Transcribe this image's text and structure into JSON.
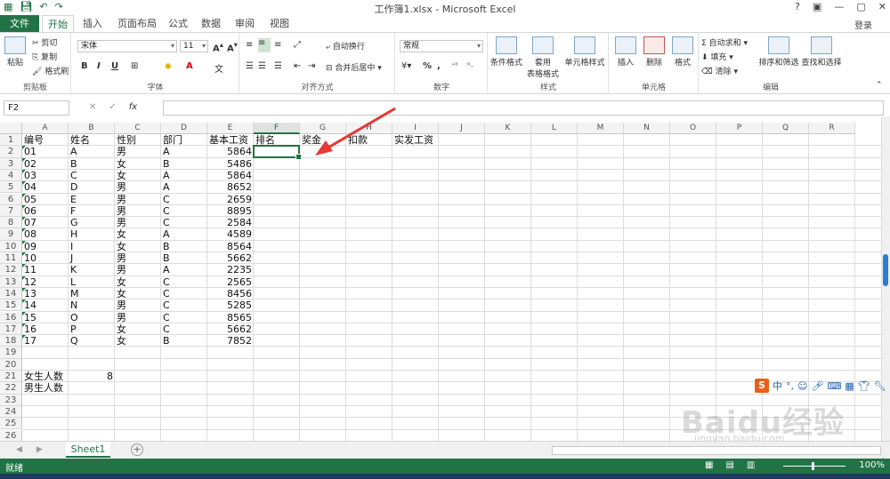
{
  "title": "工作簿1.xlsx - Microsoft Excel",
  "window_buttons": [
    "?",
    "▣",
    "—",
    "▢",
    "✕"
  ],
  "login": "登录",
  "tabs": [
    "文件",
    "开始",
    "插入",
    "页面布局",
    "公式",
    "数据",
    "审阅",
    "视图"
  ],
  "ribbon": {
    "clipboard": {
      "paste": "粘贴",
      "cut": "剪切",
      "copy": "复制",
      "format_painter": "格式刷",
      "label": "剪贴板"
    },
    "font": {
      "name": "宋体",
      "size": "11",
      "bold": "B",
      "italic": "I",
      "underline": "U",
      "label": "字体"
    },
    "alignment": {
      "wrap": "自动换行",
      "merge": "合并后居中",
      "label": "对齐方式"
    },
    "number": {
      "format": "常规",
      "percent": "%",
      "comma": ",",
      "label": "数字"
    },
    "styles": {
      "conditional": "条件格式",
      "table1": "套用",
      "table2": "表格格式",
      "cell_styles": "单元格样式",
      "label": "样式"
    },
    "cells": {
      "insert": "插入",
      "delete": "删除",
      "format": "格式",
      "label": "单元格"
    },
    "editing": {
      "autosum": "自动求和",
      "fill": "填充",
      "clear": "清除",
      "sort": "排序和筛选",
      "find": "查找和选择",
      "label": "编辑"
    }
  },
  "formula_bar": {
    "name_box": "F2",
    "fx": "fx",
    "content": ""
  },
  "columns": [
    "A",
    "B",
    "C",
    "D",
    "E",
    "F",
    "G",
    "H",
    "I",
    "J",
    "K",
    "L",
    "M",
    "N",
    "O",
    "P",
    "Q",
    "R"
  ],
  "selected_column": "F",
  "selected_cell": "F2",
  "headers": [
    "编号",
    "姓名",
    "性别",
    "部门",
    "基本工资",
    "排名",
    "奖金",
    "扣款",
    "实发工资"
  ],
  "rows": [
    [
      "01",
      "A",
      "男",
      "A",
      "5864"
    ],
    [
      "02",
      "B",
      "女",
      "B",
      "5486"
    ],
    [
      "03",
      "C",
      "女",
      "A",
      "5864"
    ],
    [
      "04",
      "D",
      "男",
      "A",
      "8652"
    ],
    [
      "05",
      "E",
      "男",
      "C",
      "2659"
    ],
    [
      "06",
      "F",
      "男",
      "C",
      "8895"
    ],
    [
      "07",
      "G",
      "男",
      "C",
      "2584"
    ],
    [
      "08",
      "H",
      "女",
      "A",
      "4589"
    ],
    [
      "09",
      "I",
      "女",
      "B",
      "8564"
    ],
    [
      "10",
      "J",
      "男",
      "B",
      "5662"
    ],
    [
      "11",
      "K",
      "男",
      "A",
      "2235"
    ],
    [
      "12",
      "L",
      "女",
      "C",
      "2565"
    ],
    [
      "13",
      "M",
      "女",
      "C",
      "8456"
    ],
    [
      "14",
      "N",
      "男",
      "C",
      "5285"
    ],
    [
      "15",
      "O",
      "男",
      "C",
      "8565"
    ],
    [
      "16",
      "P",
      "女",
      "C",
      "5662"
    ],
    [
      "17",
      "Q",
      "女",
      "B",
      "7852"
    ]
  ],
  "summary": [
    {
      "row": 21,
      "label": "女生人数",
      "value": "8"
    },
    {
      "row": 22,
      "label": "男生人数",
      "value": ""
    }
  ],
  "row_numbers": [
    1,
    2,
    3,
    4,
    5,
    6,
    7,
    8,
    9,
    10,
    11,
    12,
    13,
    14,
    15,
    16,
    17,
    18,
    19,
    20,
    21,
    22,
    23,
    24,
    25,
    26
  ],
  "sheet_tab": "Sheet1",
  "add_sheet": "+",
  "status": "就绪",
  "zoom": "100%",
  "ime": {
    "logo": "S",
    "mode": "中"
  },
  "watermark": {
    "main": "Baidu经验",
    "sub": "jingyan.baidu.com"
  },
  "colors": {
    "accent": "#217346",
    "arrow": "#e53935"
  }
}
